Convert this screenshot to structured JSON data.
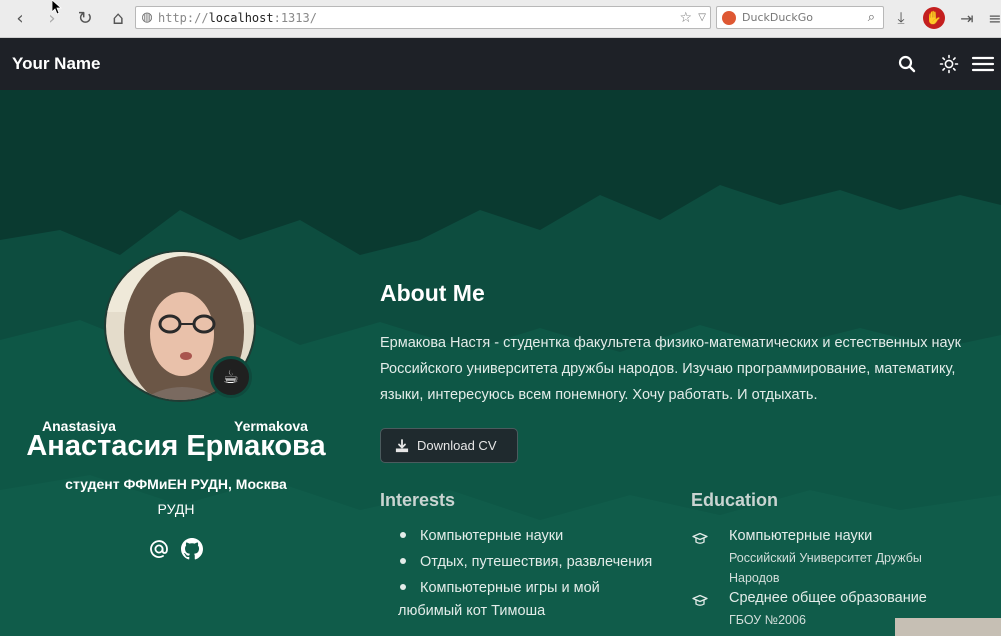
{
  "browser": {
    "url_scheme": "http://",
    "url_host": "localhost",
    "url_port": ":1313/",
    "search_engine": "DuckDuckGo",
    "icons": [
      "back-icon",
      "forward-icon",
      "reload-icon",
      "home-icon",
      "globe-icon",
      "bookmark-star-icon",
      "url-dropdown-icon",
      "search-icon",
      "download-icon",
      "ublock-icon",
      "sidebar-toggle-icon",
      "menu-icon"
    ]
  },
  "site": {
    "brand": "Your Name",
    "icons": [
      "search-icon",
      "theme-sun-icon",
      "hamburger-menu-icon"
    ]
  },
  "profile": {
    "first_name_latin": "Anastasiya",
    "last_name_latin": "Yermakova",
    "full_name": "Анастасия Ермакова",
    "role": "студент ФФМиЕН РУДН, Москва",
    "organization": "РУДН",
    "status_emoji": "☕",
    "social": [
      "email-icon",
      "github-icon"
    ]
  },
  "about": {
    "title": "About Me",
    "bio": "Ермакова Настя - студентка факультета физико-математических и естественных наук Российского университета дружбы народов. Изучаю программирование, математику, языки, интересуюсь всем понемногу. Хочу работать. И отдыхать.",
    "cv_button": "Download CV"
  },
  "interests": {
    "title": "Interests",
    "items": [
      "Компьютерные науки",
      "Отдых, путешествия, развлечения",
      "Компьютерные игры и мой",
      "любимый кот Тимоша"
    ]
  },
  "education": {
    "title": "Education",
    "items": [
      {
        "degree": "Компьютерные науки",
        "institution_line1": "Российский Университет Дружбы",
        "institution_line2": "Народов"
      },
      {
        "degree": "Среднее общее образование",
        "institution_line1": "ГБОУ №2006"
      }
    ]
  },
  "colors": {
    "header": "#1e2127",
    "hero_dark": "#0a3a30",
    "hero_mid": "#0e5746",
    "accent_text": "#e3ece9"
  }
}
